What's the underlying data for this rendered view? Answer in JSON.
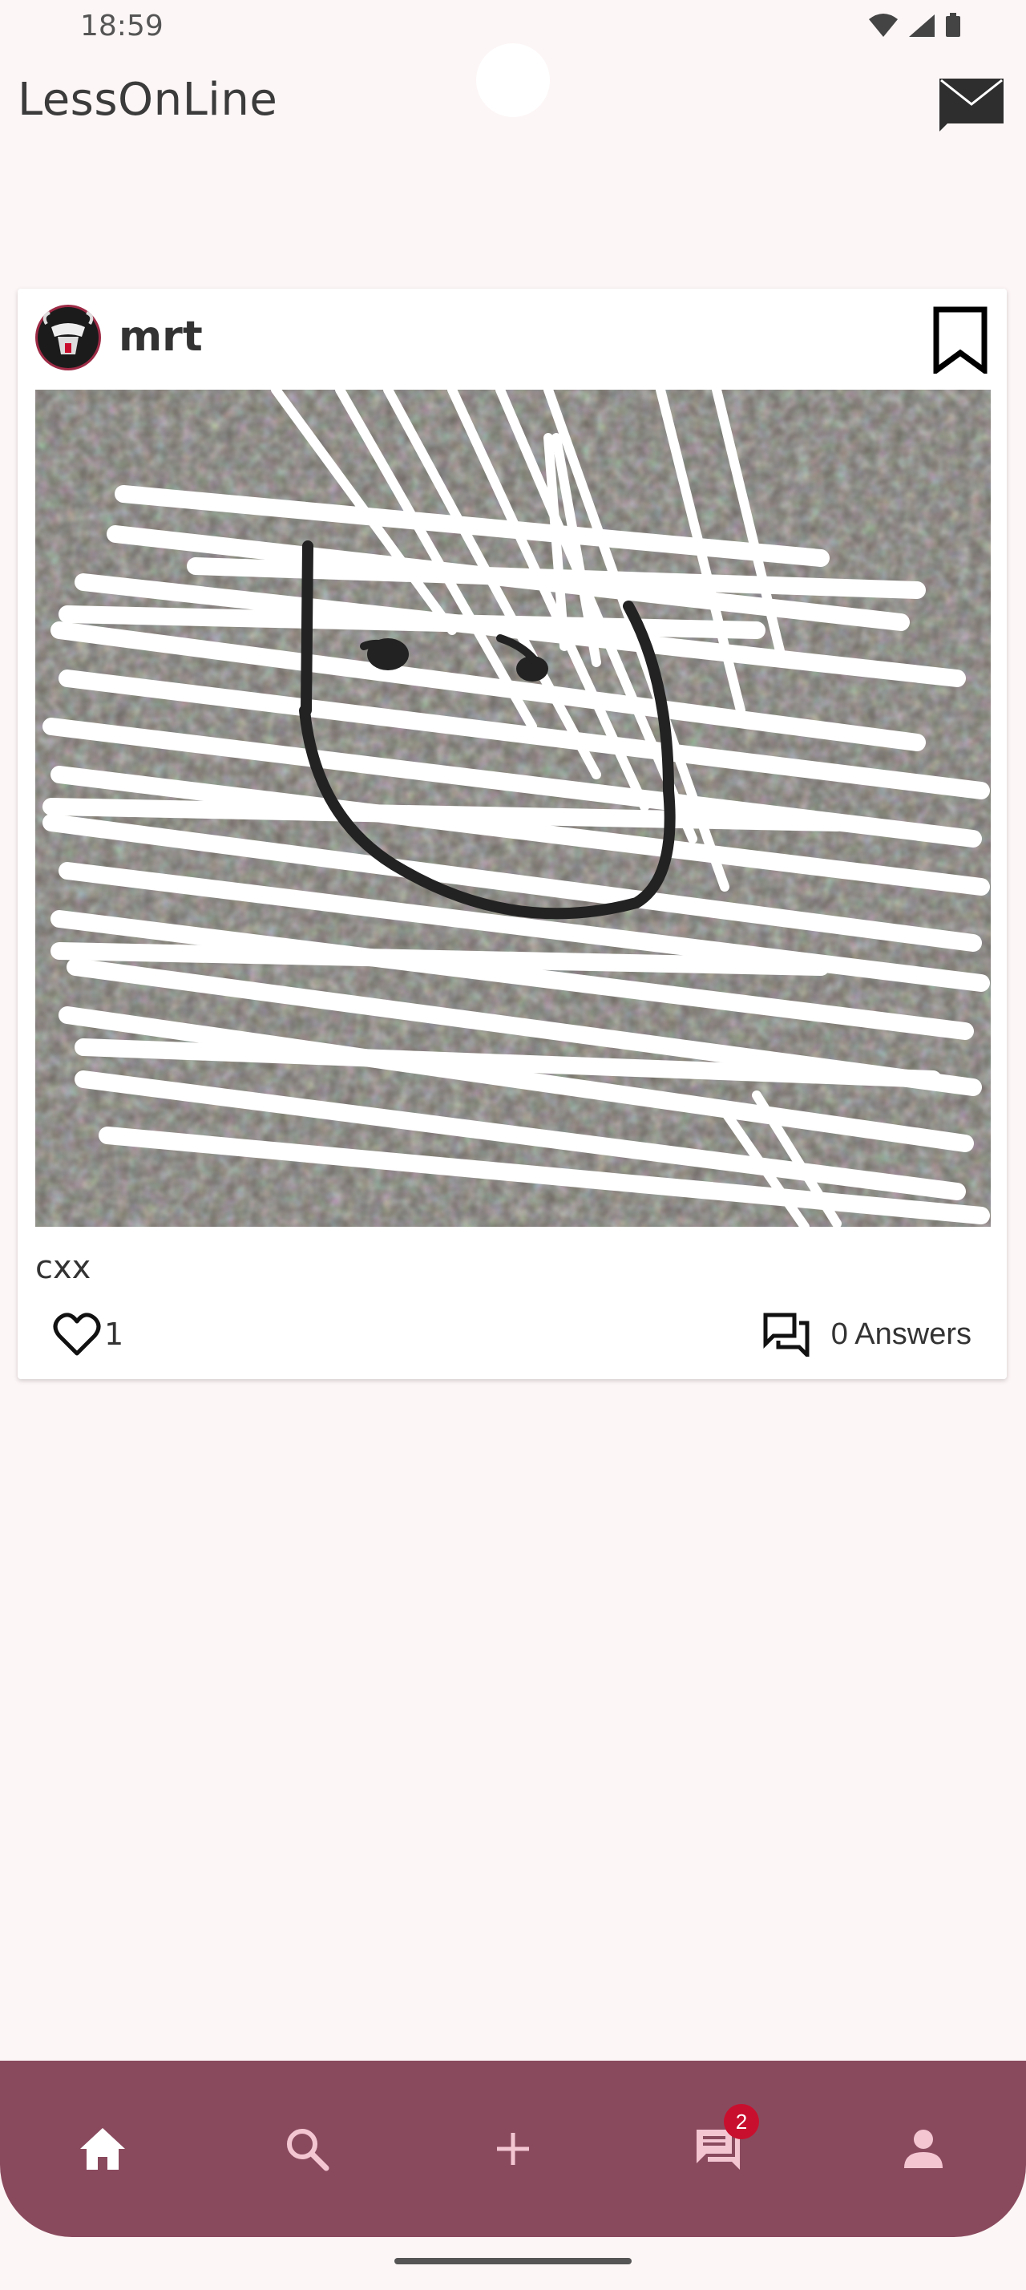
{
  "status_bar": {
    "time": "18:59"
  },
  "app": {
    "title": "LessOnLine"
  },
  "post": {
    "author": "mrt",
    "caption": "cxx",
    "likes": "1",
    "answers_label": "0 Answers"
  },
  "bottom_nav": {
    "items": [
      {
        "icon": "home-icon",
        "active": true
      },
      {
        "icon": "search-icon"
      },
      {
        "icon": "add-icon"
      },
      {
        "icon": "messages-icon",
        "badge": "2"
      },
      {
        "icon": "profile-icon"
      }
    ]
  },
  "colors": {
    "nav_bg": "#8a4a5e",
    "badge": "#c8102e",
    "page_bg": "#fdf6f6"
  }
}
